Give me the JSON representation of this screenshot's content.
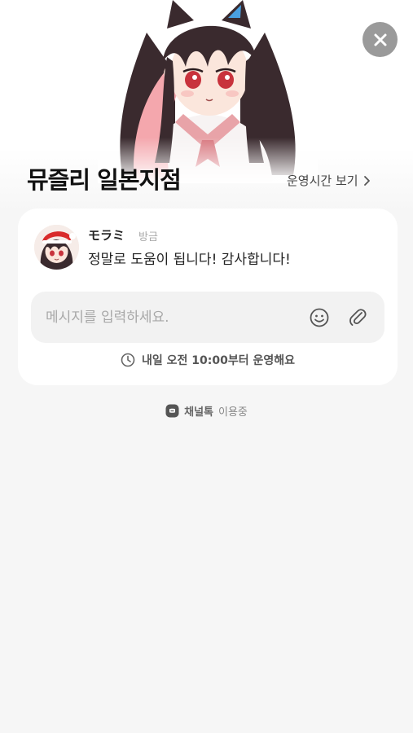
{
  "header": {
    "store_name": "뮤즐리 일본지점",
    "hours_link": "운영시간 보기"
  },
  "chat": {
    "sender": "モラミ",
    "time": "방금",
    "message": "정말로 도움이 됩니다! 감사합니다!",
    "input_placeholder": "메시지를 입력하세요.",
    "hours_note": "내일 오전 10:00부터 운영해요"
  },
  "footer": {
    "brand": "채널톡",
    "suffix": "이용중"
  },
  "icons": {
    "close": "close-icon",
    "chevron": "chevron-right-icon",
    "emoji": "smiley-icon",
    "attach": "paperclip-icon",
    "clock": "clock-icon",
    "channel": "channel-talk-icon"
  },
  "colors": {
    "background": "#f6f6f6",
    "card": "#ffffff",
    "close_button": "#9a9a9a",
    "input_bg": "#f2f2f2"
  }
}
